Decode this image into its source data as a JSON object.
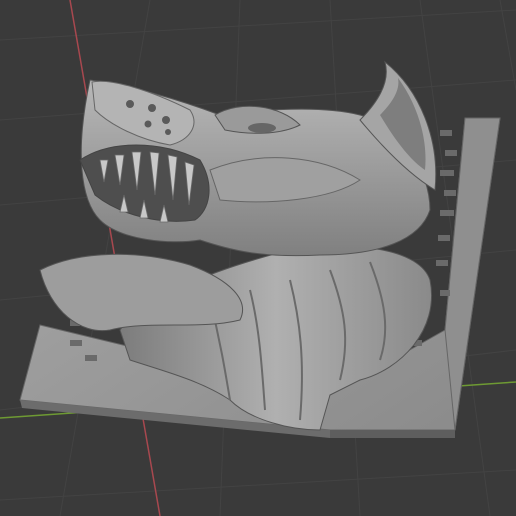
{
  "viewport": {
    "background": "#3a3a3a",
    "grid_color": "#434343",
    "x_axis_color": "#a8484f",
    "y_axis_color": "#6e9a33"
  },
  "model": {
    "name_icon": "wolf-head-plaque-model",
    "base_color": "#9a9a9a",
    "highlight_color": "#c4c4c4",
    "shadow_color": "#555555"
  }
}
